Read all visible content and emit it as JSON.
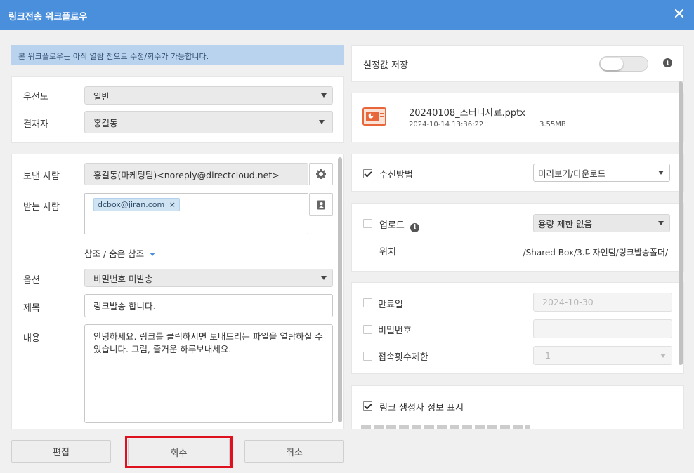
{
  "window": {
    "title": "링크전송 워크플로우"
  },
  "notice": "본 워크플로우는 아직 열람 전으로 수정/회수가 가능합니다.",
  "approval": {
    "priority_label": "우선도",
    "priority_value": "일반",
    "approver_label": "결재자",
    "approver_value": "홍길동"
  },
  "message": {
    "sender_label": "보낸 사람",
    "sender_value": "홍길동(마케팅팀)<noreply@directcloud.net>",
    "recipient_label": "받는 사람",
    "recipient_chip": "dcbox@jiran.com",
    "cc_link": "참조 / 숨은 참조",
    "option_label": "옵션",
    "option_value": "비밀번호 미발송",
    "subject_label": "제목",
    "subject_value": "링크발송 합니다.",
    "body_label": "내용",
    "body_value": "안녕하세요. 링크를 클릭하시면 보내드리는 파일을 열람하실 수 있습니다. 그럼, 즐거운 하루보내세요."
  },
  "settings": {
    "save_label": "설정값 저장",
    "save_toggle_on": false
  },
  "file": {
    "name": "20240108_스터디자료.pptx",
    "date": "2024-10-14 13:36:22",
    "size": "3.55MB",
    "icon": "pptx-file-icon",
    "icon_color": "#e8673a"
  },
  "receive": {
    "label": "수신방법",
    "checked": true,
    "value": "미리보기/다운로드"
  },
  "upload": {
    "label": "업로드",
    "checked": false,
    "value": "용량 제한 없음",
    "location_label": "위치",
    "location_value": "/Shared Box/3.디자인팀/링크발송폴더/"
  },
  "limits": {
    "expiry_label": "만료일",
    "expiry_value": "2024-10-30",
    "password_label": "비밀번호",
    "password_value": "",
    "access_label": "접속횟수제한",
    "access_value": "1"
  },
  "creator": {
    "label": "링크 생성자 정보 표시",
    "checked": true
  },
  "buttons": {
    "edit": "편집",
    "recall": "회수",
    "cancel": "취소"
  },
  "colors": {
    "titlebar": "#4a8fdc",
    "notice_bg": "#b9d3ee",
    "chip_bg": "#cfe3f3",
    "highlight": "#e0111f"
  }
}
